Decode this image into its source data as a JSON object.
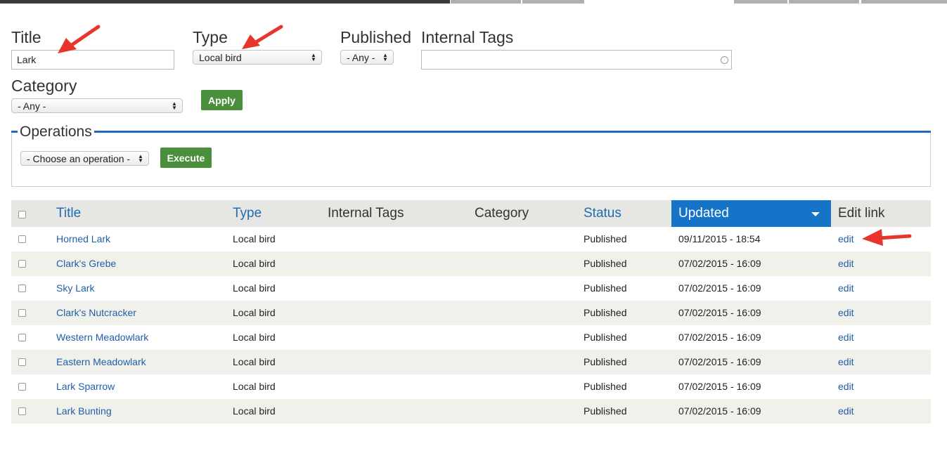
{
  "filters": {
    "title_label": "Title",
    "title_value": "Lark",
    "type_label": "Type",
    "type_value": "Local bird",
    "published_label": "Published",
    "published_value": "- Any -",
    "internal_tags_label": "Internal Tags",
    "internal_tags_value": "",
    "category_label": "Category",
    "category_value": "- Any -",
    "apply_label": "Apply"
  },
  "operations": {
    "legend": "Operations",
    "select_value": "- Choose an operation -",
    "execute_label": "Execute"
  },
  "table": {
    "headers": {
      "title": "Title",
      "type": "Type",
      "internal_tags": "Internal Tags",
      "category": "Category",
      "status": "Status",
      "updated": "Updated",
      "edit_link": "Edit link"
    },
    "rows": [
      {
        "title": "Horned Lark",
        "type": "Local bird",
        "internal_tags": "",
        "category": "",
        "status": "Published",
        "updated": "09/11/2015 - 18:54",
        "edit": "edit"
      },
      {
        "title": "Clark's Grebe",
        "type": "Local bird",
        "internal_tags": "",
        "category": "",
        "status": "Published",
        "updated": "07/02/2015 - 16:09",
        "edit": "edit"
      },
      {
        "title": "Sky Lark",
        "type": "Local bird",
        "internal_tags": "",
        "category": "",
        "status": "Published",
        "updated": "07/02/2015 - 16:09",
        "edit": "edit"
      },
      {
        "title": "Clark's Nutcracker",
        "type": "Local bird",
        "internal_tags": "",
        "category": "",
        "status": "Published",
        "updated": "07/02/2015 - 16:09",
        "edit": "edit"
      },
      {
        "title": "Western Meadowlark",
        "type": "Local bird",
        "internal_tags": "",
        "category": "",
        "status": "Published",
        "updated": "07/02/2015 - 16:09",
        "edit": "edit"
      },
      {
        "title": "Eastern Meadowlark",
        "type": "Local bird",
        "internal_tags": "",
        "category": "",
        "status": "Published",
        "updated": "07/02/2015 - 16:09",
        "edit": "edit"
      },
      {
        "title": "Lark Sparrow",
        "type": "Local bird",
        "internal_tags": "",
        "category": "",
        "status": "Published",
        "updated": "07/02/2015 - 16:09",
        "edit": "edit"
      },
      {
        "title": "Lark Bunting",
        "type": "Local bird",
        "internal_tags": "",
        "category": "",
        "status": "Published",
        "updated": "07/02/2015 - 16:09",
        "edit": "edit"
      }
    ]
  },
  "colors": {
    "accent_blue": "#1574c7",
    "link_blue": "#1f5fa8",
    "button_green": "#4a8f3c",
    "annotation_red": "#e8352b"
  }
}
